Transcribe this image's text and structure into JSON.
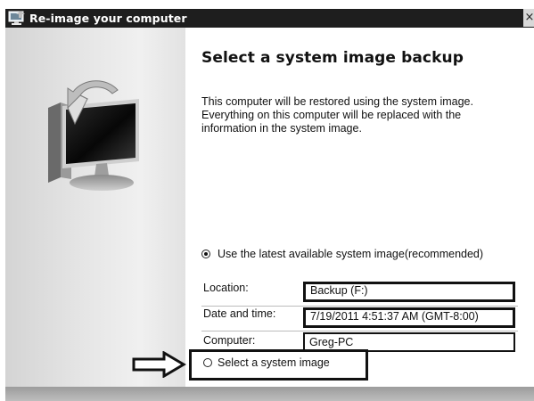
{
  "window": {
    "title": "Re-image your computer",
    "close_glyph": "×"
  },
  "content": {
    "heading": "Select a system image backup",
    "description": "This computer will be restored using the system image. Everything on this computer will be replaced with the information in the system image.",
    "options": {
      "latest": {
        "label": "Use the latest available system image(recommended)",
        "selected": true
      },
      "select": {
        "label": "Select a system image",
        "selected": false
      }
    },
    "fields": [
      {
        "label": "Location:",
        "value": "Backup (F:)"
      },
      {
        "label": "Date and time:",
        "value": "7/19/2011 4:51:37 AM (GMT-8:00)"
      },
      {
        "label": "Computer:",
        "value": "Greg-PC"
      }
    ]
  },
  "icons": {
    "title": "window-icon",
    "sidebar": "computer-restore-icon",
    "callout": "arrow-right-icon"
  }
}
